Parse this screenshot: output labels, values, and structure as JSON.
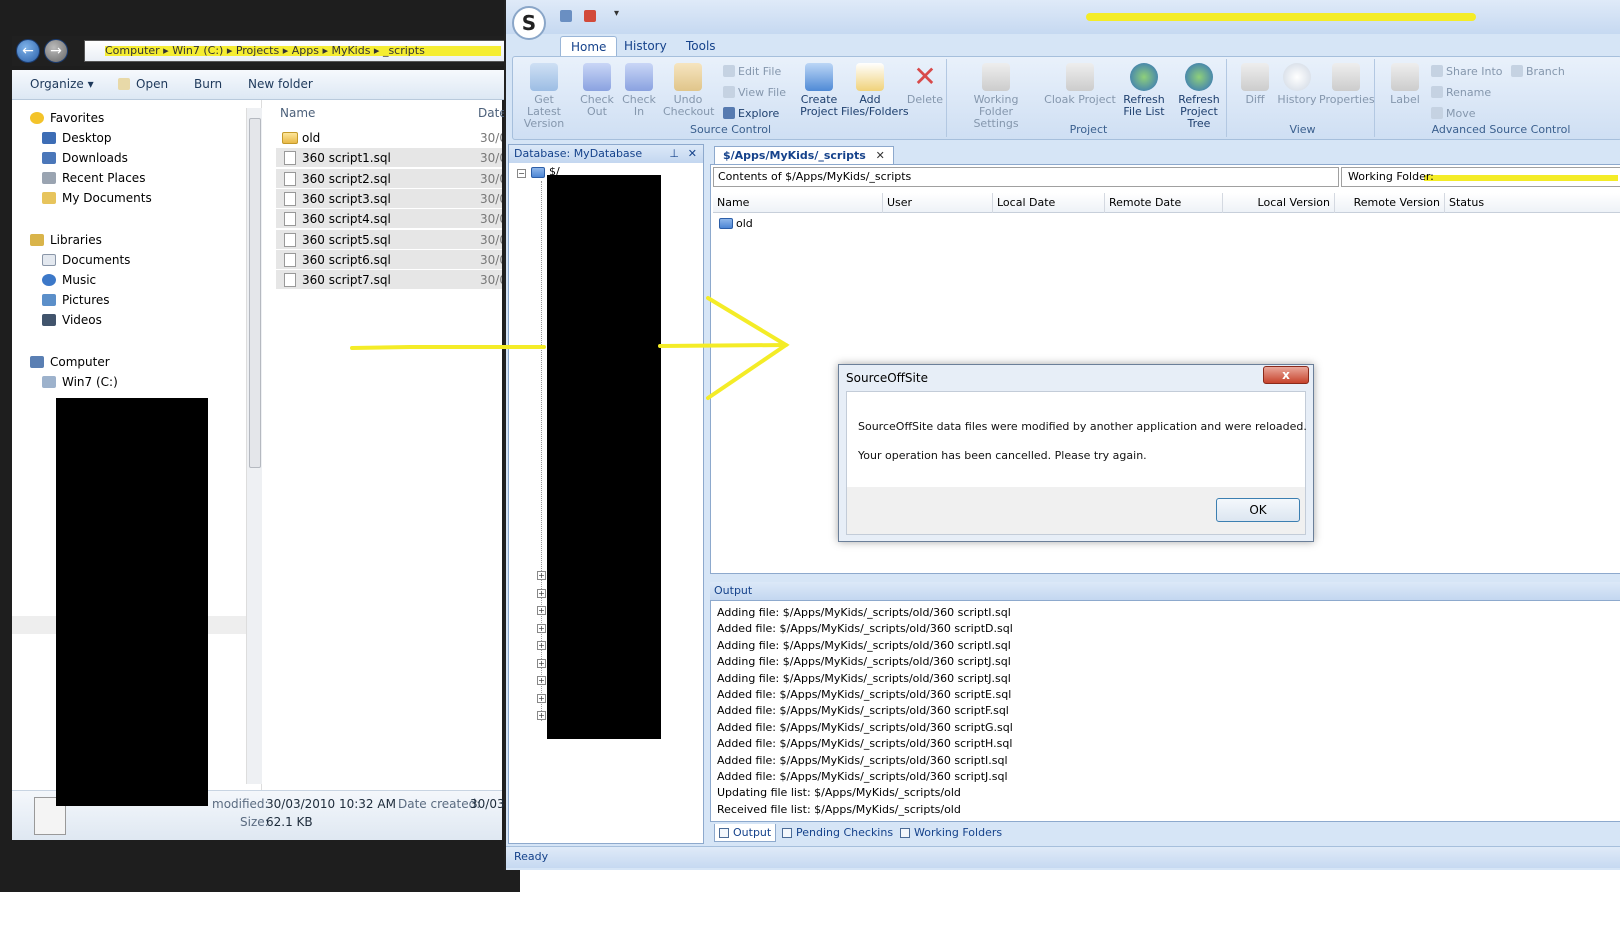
{
  "explorer": {
    "address_segments": "Computer ▸ Win7 (C:) ▸ Projects ▸ Apps ▸ MyKids ▸ _scripts",
    "toolbar": {
      "organize": "Organize ▾",
      "open": "Open",
      "burn": "Burn",
      "new_folder": "New folder"
    },
    "nav": {
      "favorites": "Favorites",
      "desktop": "Desktop",
      "downloads": "Downloads",
      "recent_places": "Recent Places",
      "my_documents": "My Documents",
      "libraries": "Libraries",
      "documents": "Documents",
      "music": "Music",
      "pictures": "Pictures",
      "videos": "Videos",
      "computer": "Computer",
      "win7": "Win7 (C:)"
    },
    "columns": {
      "name": "Name",
      "date": "Date"
    },
    "files": [
      {
        "name": "old",
        "date": "30/0",
        "type": "folder"
      },
      {
        "name": "360 script1.sql",
        "date": "30/0",
        "type": "file"
      },
      {
        "name": "360 script2.sql",
        "date": "30/0",
        "type": "file"
      },
      {
        "name": "360 script3.sql",
        "date": "30/0",
        "type": "file"
      },
      {
        "name": "360 script4.sql",
        "date": "30/0",
        "type": "file"
      },
      {
        "name": "360 script5.sql",
        "date": "30/0",
        "type": "file"
      },
      {
        "name": "360 script6.sql",
        "date": "30/0",
        "type": "file"
      },
      {
        "name": "360 script7.sql",
        "date": "30/0",
        "type": "file"
      }
    ],
    "details": {
      "modified_label": "modified:",
      "modified_value": "30/03/2010 10:32 AM",
      "created_label": "Date created:",
      "created_value": "30/03",
      "size_label": "Size:",
      "size_value": "62.1 KB"
    }
  },
  "sos": {
    "logo_letter": "S",
    "tabs": [
      "Home",
      "History",
      "Tools"
    ],
    "ribbon": {
      "get_latest": "Get Latest Version",
      "check_out": "Check Out",
      "check_in": "Check In",
      "undo_checkout": "Undo Checkout",
      "edit_file": "Edit File",
      "view_file": "View File",
      "explore": "Explore",
      "create_project": "Create Project",
      "add_files": "Add Files/Folders",
      "delete": "Delete",
      "source_control_group": "Source Control",
      "working_folder": "Working Folder Settings",
      "cloak_project": "Cloak Project",
      "refresh_file_list": "Refresh File List",
      "refresh_project_tree": "Refresh Project Tree",
      "project_group": "Project",
      "diff": "Diff",
      "history": "History",
      "properties": "Properties",
      "view_group": "View",
      "label": "Label",
      "share_into": "Share Into",
      "rename": "Rename",
      "move": "Move",
      "branch": "Branch",
      "advanced_group": "Advanced Source Control"
    },
    "db_panel": {
      "title": "Database: MyDatabase",
      "root": "$/"
    },
    "doc_tab": "$/Apps/MyKids/_scripts",
    "contents_of": "Contents of $/Apps/MyKids/_scripts",
    "working_folder_label": "Working Folder:",
    "grid_columns": [
      "Name",
      "User",
      "Local Date",
      "Remote Date",
      "Local Version",
      "Remote Version",
      "Status"
    ],
    "grid_rows": [
      {
        "name": "old"
      }
    ],
    "output_title": "Output",
    "output_lines": [
      "Adding file: $/Apps/MyKids/_scripts/old/360 scriptI.sql",
      "Added file: $/Apps/MyKids/_scripts/old/360 scriptD.sql",
      "Adding file: $/Apps/MyKids/_scripts/old/360 scriptI.sql",
      "Adding file: $/Apps/MyKids/_scripts/old/360 scriptJ.sql",
      "Adding file: $/Apps/MyKids/_scripts/old/360 scriptJ.sql",
      "Added file: $/Apps/MyKids/_scripts/old/360 scriptE.sql",
      "Added file: $/Apps/MyKids/_scripts/old/360 scriptF.sql",
      "Added file: $/Apps/MyKids/_scripts/old/360 scriptG.sql",
      "Added file: $/Apps/MyKids/_scripts/old/360 scriptH.sql",
      "Added file: $/Apps/MyKids/_scripts/old/360 scriptI.sql",
      "Added file: $/Apps/MyKids/_scripts/old/360 scriptJ.sql",
      "Updating file list: $/Apps/MyKids/_scripts/old",
      "Received file list: $/Apps/MyKids/_scripts/old"
    ],
    "output_tabs": [
      "Output",
      "Pending Checkins",
      "Working Folders"
    ],
    "status": "Ready"
  },
  "dialog": {
    "title": "SourceOffSite",
    "close": "x",
    "message1": "SourceOffSite data files were modified by another application and were reloaded.",
    "message2": "Your operation has been cancelled.  Please try again.",
    "ok": "OK"
  },
  "colors": {
    "annotation": "#f4ec27",
    "ribbon_text": "#15428b"
  }
}
